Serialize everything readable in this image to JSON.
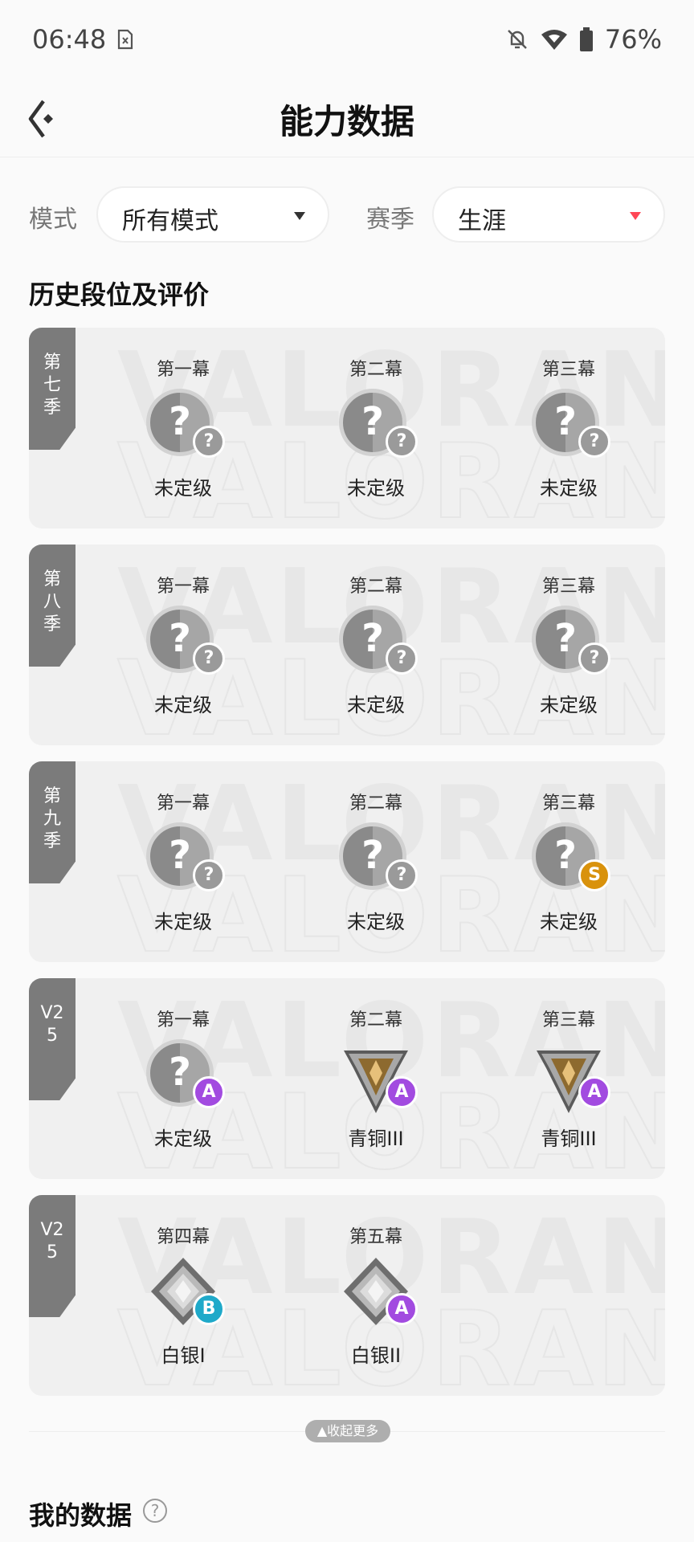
{
  "status_bar": {
    "time": "06:48",
    "battery": "76%",
    "icons": [
      "sim-icon",
      "mute-bell-icon",
      "wifi-icon",
      "battery-icon"
    ]
  },
  "header": {
    "title": "能力数据",
    "back_icon": "back-arrow-icon"
  },
  "filters": {
    "mode_label": "模式",
    "mode_value": "所有模式",
    "season_label": "赛季",
    "season_value": "生涯",
    "accent": "#ff4655"
  },
  "history": {
    "title": "历史段位及评价",
    "watermark": "VALORANT",
    "cards": [
      {
        "season": [
          "第",
          "七",
          "季"
        ],
        "acts": [
          {
            "name": "第一幕",
            "rank": "未定级",
            "badge": "?"
          },
          {
            "name": "第二幕",
            "rank": "未定级",
            "badge": "?"
          },
          {
            "name": "第三幕",
            "rank": "未定级",
            "badge": "?"
          }
        ]
      },
      {
        "season": [
          "第",
          "八",
          "季"
        ],
        "acts": [
          {
            "name": "第一幕",
            "rank": "未定级",
            "badge": "?"
          },
          {
            "name": "第二幕",
            "rank": "未定级",
            "badge": "?"
          },
          {
            "name": "第三幕",
            "rank": "未定级",
            "badge": "?"
          }
        ]
      },
      {
        "season": [
          "第",
          "九",
          "季"
        ],
        "acts": [
          {
            "name": "第一幕",
            "rank": "未定级",
            "badge": "?"
          },
          {
            "name": "第二幕",
            "rank": "未定级",
            "badge": "?"
          },
          {
            "name": "第三幕",
            "rank": "未定级",
            "badge": "S"
          }
        ]
      },
      {
        "season": [
          "V2",
          "5"
        ],
        "acts": [
          {
            "name": "第一幕",
            "rank": "未定级",
            "badge": "A"
          },
          {
            "name": "第二幕",
            "rank": "青铜III",
            "badge": "A"
          },
          {
            "name": "第三幕",
            "rank": "青铜III",
            "badge": "A"
          }
        ]
      },
      {
        "season": [
          "V2",
          "5"
        ],
        "acts": [
          {
            "name": "第四幕",
            "rank": "白银I",
            "badge": "B"
          },
          {
            "name": "第五幕",
            "rank": "白银II",
            "badge": "A"
          }
        ]
      }
    ],
    "collapse_label": "▲收起更多"
  },
  "my_data": {
    "title": "我的数据",
    "help_icon": "help-circle-icon"
  }
}
